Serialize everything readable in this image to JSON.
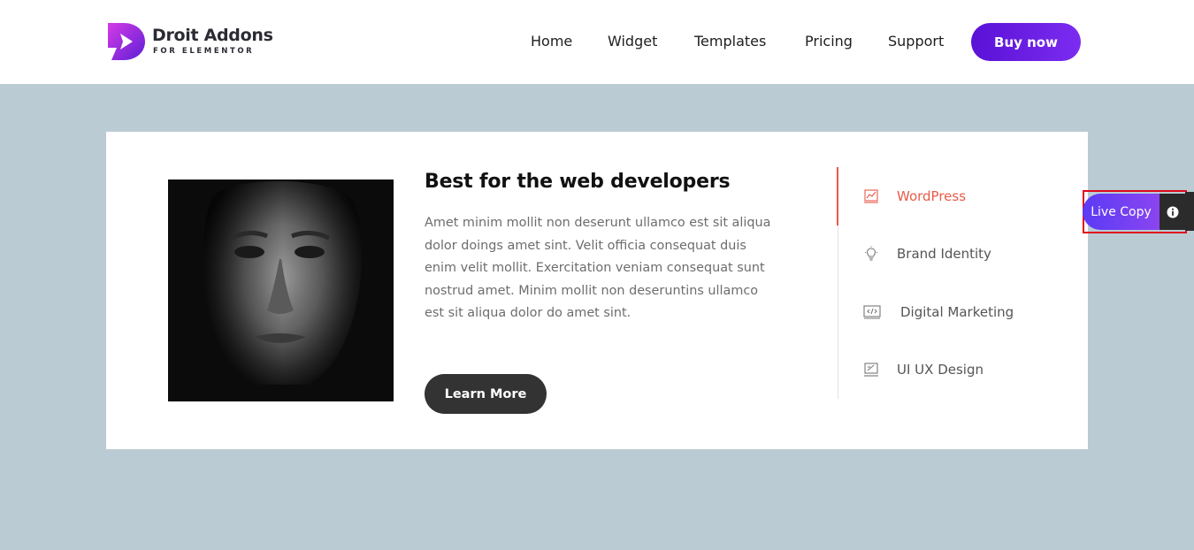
{
  "header": {
    "logo_title": "Droit Addons",
    "logo_subtitle": "FOR ELEMENTOR",
    "nav": [
      "Home",
      "Widget",
      "Templates",
      "Pricing",
      "Support"
    ],
    "cta_label": "Buy now",
    "cta_gradient": [
      "#5a12d6",
      "#7b2cf0"
    ]
  },
  "card": {
    "heading": "Best for the web developers",
    "body": "Amet minim mollit non deserunt ullamco est sit aliqua dolor doings amet sint. Velit officia consequat duis enim velit mollit. Exercitation veniam consequat sunt nostrud amet. Minim mollit non deseruntins ullamco est sit aliqua dolor do amet sint.",
    "button_label": "Learn More",
    "tabs": [
      {
        "label": "WordPress",
        "icon": "chart-icon",
        "active": true
      },
      {
        "label": "Brand Identity",
        "icon": "lightbulb-icon",
        "active": false
      },
      {
        "label": "Digital Marketing",
        "icon": "code-window-icon",
        "active": false
      },
      {
        "label": "UI UX Design",
        "icon": "design-screen-icon",
        "active": false
      }
    ],
    "accent_color": "#e85a4a"
  },
  "live_copy": {
    "label": "Live Copy",
    "info_icon": "info-icon"
  },
  "colors": {
    "page_background": "#bacbd3",
    "card_background": "#ffffff",
    "dark_button": "#333333"
  }
}
